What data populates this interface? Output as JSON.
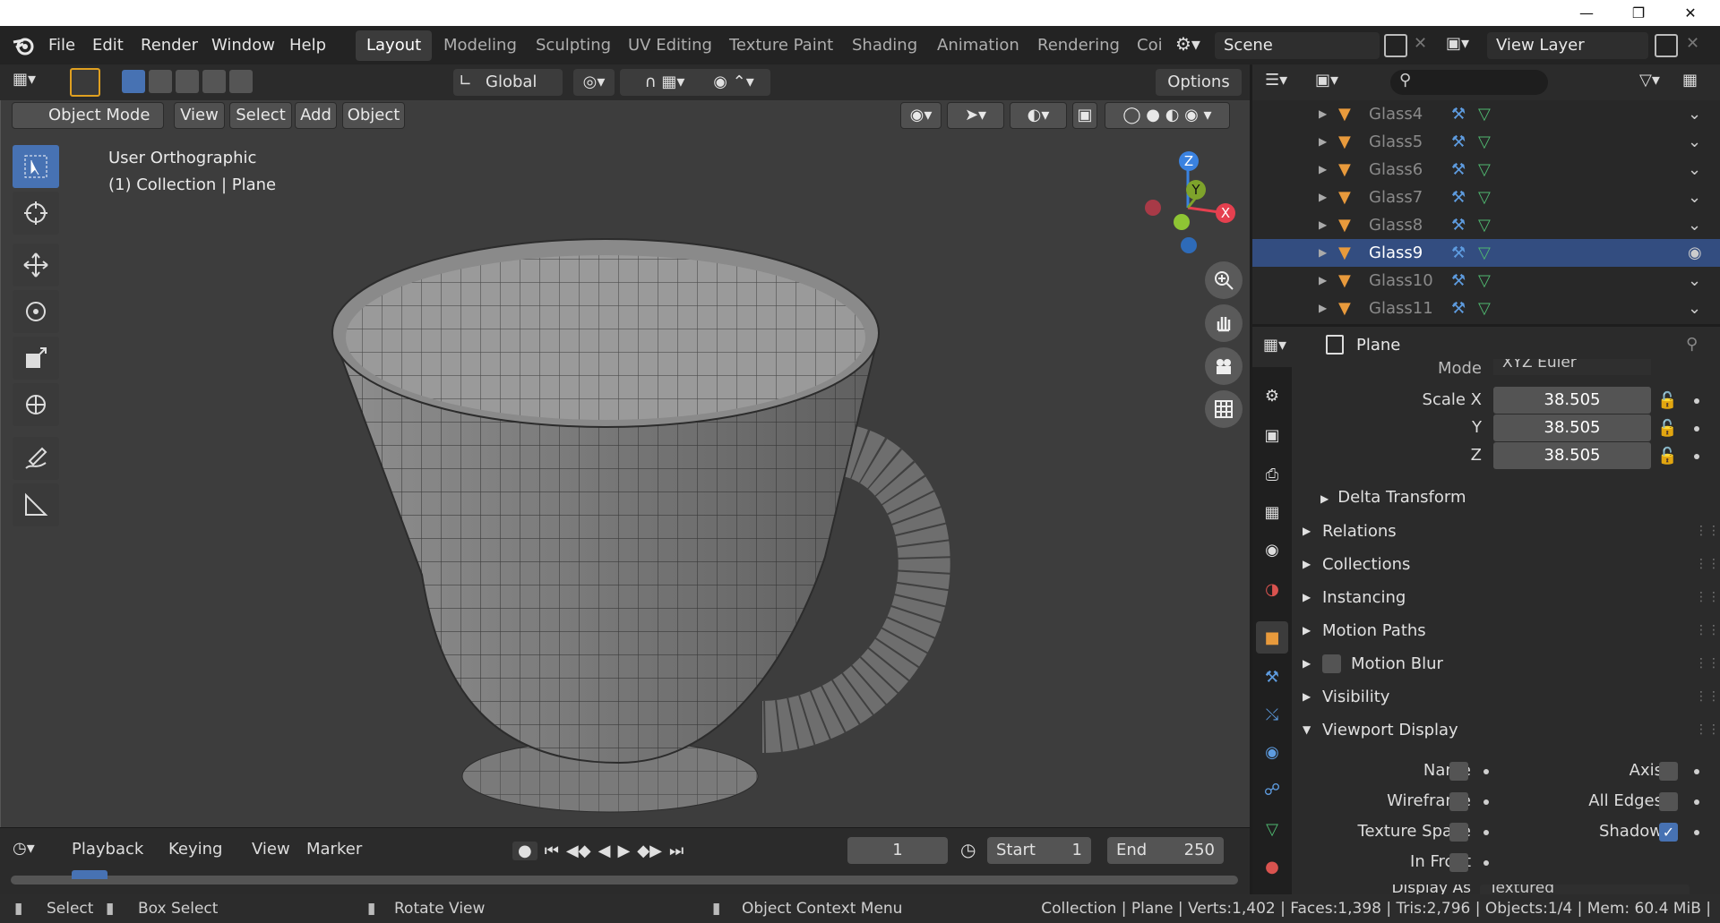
{
  "menu": {
    "file": "File",
    "edit": "Edit",
    "render": "Render",
    "window": "Window",
    "help": "Help"
  },
  "workspaces": [
    "Layout",
    "Modeling",
    "Sculpting",
    "UV Editing",
    "Texture Paint",
    "Shading",
    "Animation",
    "Rendering",
    "Coi"
  ],
  "scene": {
    "name": "Scene",
    "view_layer": "View Layer"
  },
  "header": {
    "orientation": "Global",
    "options": "Options"
  },
  "viewport_header": {
    "mode": "Object Mode",
    "view": "View",
    "select": "Select",
    "add": "Add",
    "object": "Object"
  },
  "viewport": {
    "view_name": "User Orthographic",
    "collection_info": "(1) Collection | Plane"
  },
  "gizmo": {
    "z": "Z",
    "y": "Y",
    "x": "X"
  },
  "outliner": {
    "items": [
      {
        "name": "Glass4",
        "selected": false
      },
      {
        "name": "Glass5",
        "selected": false
      },
      {
        "name": "Glass6",
        "selected": false
      },
      {
        "name": "Glass7",
        "selected": false
      },
      {
        "name": "Glass8",
        "selected": false
      },
      {
        "name": "Glass9",
        "selected": true
      },
      {
        "name": "Glass10",
        "selected": false
      },
      {
        "name": "Glass11",
        "selected": false
      }
    ]
  },
  "properties": {
    "object_name": "Plane",
    "mode_label": "Mode",
    "mode_value": "XYZ Euler",
    "scale_x_label": "Scale X",
    "scale_x": "38.505",
    "scale_y_label": "Y",
    "scale_y": "38.505",
    "scale_z_label": "Z",
    "scale_z": "38.505",
    "delta_transform": "Delta Transform",
    "panels": [
      "Relations",
      "Collections",
      "Instancing",
      "Motion Paths",
      "Motion Blur",
      "Visibility",
      "Viewport Display"
    ],
    "vd": {
      "name": "Name",
      "axis": "Axis",
      "wireframe": "Wireframe",
      "all_edges": "All Edges",
      "texture_space": "Texture Space",
      "shadow": "Shadow",
      "in_front": "In Front",
      "display_as_label": "Display As",
      "display_as_value": "Textured"
    }
  },
  "timeline": {
    "playback": "Playback",
    "keying": "Keying",
    "view": "View",
    "marker": "Marker",
    "current_frame": "1",
    "start_label": "Start",
    "start": "1",
    "end_label": "End",
    "end": "250"
  },
  "status": {
    "select": "Select",
    "box_select": "Box Select",
    "rotate_view": "Rotate View",
    "context_menu": "Object Context Menu",
    "stats": "Collection | Plane | Verts:1,402 | Faces:1,398 | Tris:2,796 | Objects:1/4 | Mem: 60.4 MiB |"
  },
  "colors": {
    "accent": "#4772b3",
    "background": "#3d3d3d",
    "outliner_selected": "#334d80",
    "gizmo_x": "#e5404f",
    "gizmo_y": "#7ea32b",
    "gizmo_z": "#3a82e0"
  }
}
